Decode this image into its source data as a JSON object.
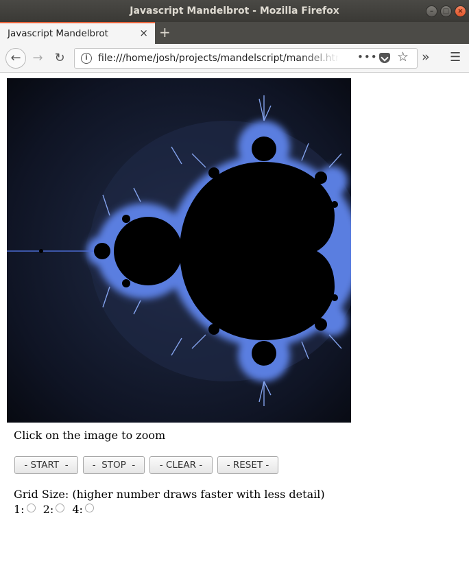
{
  "window": {
    "title": "Javascript Mandelbrot - Mozilla Firefox"
  },
  "tab": {
    "label": "Javascript Mandelbrot",
    "close": "×",
    "new_tab": "+"
  },
  "nav": {
    "back": "←",
    "forward": "→",
    "reload": "↻",
    "url": "file:///home/josh/projects/mandelscript/mandel.htm",
    "more": "•••",
    "star": "☆",
    "overflow": "»",
    "menu": "☰"
  },
  "page": {
    "instruction": "Click on the image to zoom",
    "buttons": {
      "start": "- START  -",
      "stop": "-  STOP  -",
      "clear": "- CLEAR -",
      "reset": "- RESET -"
    },
    "grid_title": "Grid Size: (higher number draws faster with less detail)",
    "grid_options": [
      "1:",
      "2:",
      "4:"
    ]
  },
  "colors": {
    "fractal_edge": "#7aa0ff",
    "fractal_bg": "#0a0c14",
    "accent_tab": "#e8643c"
  }
}
